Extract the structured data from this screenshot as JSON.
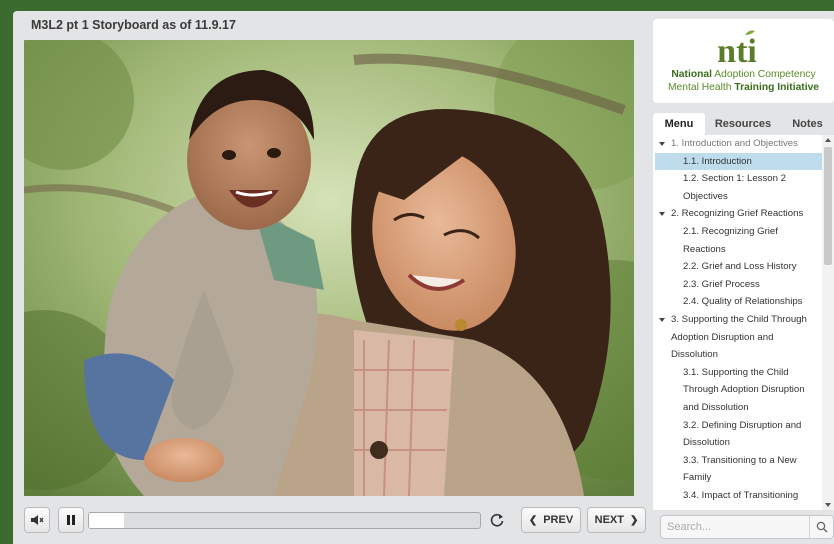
{
  "player": {
    "title": "M3L2 pt 1 Storyboard as of 11.9.17"
  },
  "slide": {
    "image": "photo of smiling woman holding laughing toddler outdoors"
  },
  "controls": {
    "volume_icon": "volume-icon",
    "pause_icon": "pause-icon",
    "progress_fraction": 0.09,
    "replay_icon": "replay-icon",
    "prev_label": "PREV",
    "next_label": "NEXT"
  },
  "logo": {
    "mark": "nti",
    "line1_bold": "National",
    "line1_rest": " Adoption Competency",
    "line2_start": "Mental Health ",
    "line2_bold": "Training Initiative"
  },
  "tabs": [
    {
      "label": "Menu",
      "active": true
    },
    {
      "label": "Resources",
      "active": false
    },
    {
      "label": "Notes",
      "active": false
    }
  ],
  "menu": [
    {
      "type": "section",
      "label": "1. Introduction and Objectives",
      "dim": true
    },
    {
      "type": "item",
      "label": "1.1. Introduction",
      "selected": true
    },
    {
      "type": "item",
      "label": "1.2. Section 1: Lesson 2"
    },
    {
      "type": "cont-i",
      "label": "Objectives"
    },
    {
      "type": "section",
      "label": "2. Recognizing Grief Reactions"
    },
    {
      "type": "item",
      "label": "2.1. Recognizing Grief"
    },
    {
      "type": "cont-i",
      "label": "Reactions"
    },
    {
      "type": "item",
      "label": "2.2. Grief and Loss History"
    },
    {
      "type": "item",
      "label": "2.3. Grief Process"
    },
    {
      "type": "item",
      "label": "2.4. Quality of Relationships"
    },
    {
      "type": "section",
      "label": "3. Supporting the Child Through"
    },
    {
      "type": "cont-s",
      "label": "Adoption Disruption and"
    },
    {
      "type": "cont-s",
      "label": "Dissolution"
    },
    {
      "type": "item",
      "label": "3.1. Supporting the Child"
    },
    {
      "type": "cont-i",
      "label": "Through Adoption Disruption"
    },
    {
      "type": "cont-i",
      "label": "and Dissolution"
    },
    {
      "type": "item",
      "label": "3.2. Defining Disruption and"
    },
    {
      "type": "cont-i",
      "label": "Dissolution"
    },
    {
      "type": "item",
      "label": "3.3. Transitioning to a New"
    },
    {
      "type": "cont-i",
      "label": "Family"
    },
    {
      "type": "item",
      "label": "3.4. Impact of Transitioning"
    }
  ],
  "search": {
    "placeholder": "Search..."
  },
  "colors": {
    "background": "#3c6b30",
    "selected_row": "#bfdcec",
    "logo_green": "#5a8a2a"
  }
}
